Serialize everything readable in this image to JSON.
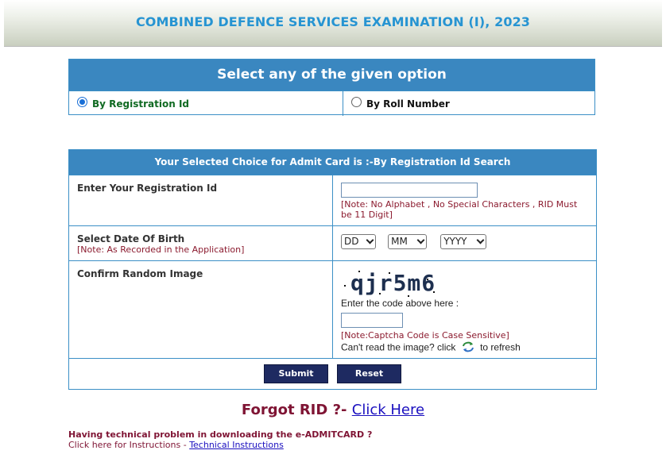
{
  "header": {
    "title": "COMBINED DEFENCE SERVICES EXAMINATION (I), 2023"
  },
  "option_panel": {
    "heading": "Select any of the given option",
    "options": [
      {
        "label": "By Registration Id",
        "selected": true
      },
      {
        "label": "By Roll Number",
        "selected": false
      }
    ]
  },
  "form": {
    "heading": "Your Selected Choice for Admit Card is :-By Registration Id Search",
    "rid": {
      "label": "Enter Your Registration Id",
      "value": "",
      "note": "[Note: No Alphabet , No Special Characters , RID Must be 11 Digit]"
    },
    "dob": {
      "label": "Select Date Of Birth",
      "note": "[Note: As Recorded in the Application]",
      "day": "DD",
      "month": "MM",
      "year": "YYYY"
    },
    "captcha": {
      "label": "Confirm Random Image",
      "code": "qjr5m6",
      "prompt": "Enter the code above here :",
      "value": "",
      "note": "[Note:Captcha Code is Case Sensitive]",
      "refresh_before": "Can't read the image? click",
      "refresh_after": "to refresh",
      "refresh_icon": "refresh-icon"
    },
    "submit_label": "Submit",
    "reset_label": "Reset"
  },
  "forgot": {
    "text": "Forgot RID ?-",
    "link": "Click Here"
  },
  "footer": {
    "problem": "Having technical problem in downloading the e-ADMITCARD ?",
    "instructions_prefix": "Click here for Instructions -",
    "instructions_link": "Technical Instructions"
  },
  "colors": {
    "title_blue": "#2794d2",
    "header_band": "#3a87c0",
    "button_navy": "#1e2a61",
    "note_maroon": "#8b1a2e",
    "selected_green": "#106a22",
    "link_blue": "#1a0fbf"
  }
}
